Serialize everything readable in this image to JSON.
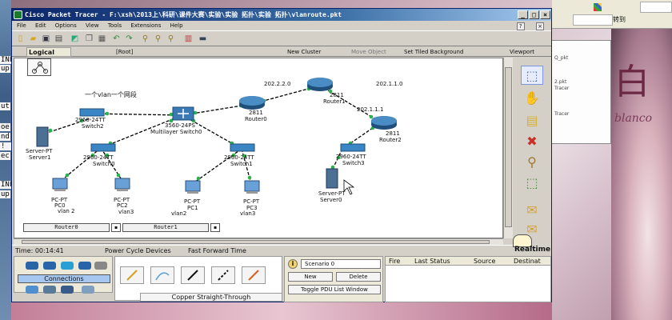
{
  "window": {
    "title": "Cisco Packet Tracer - F:\\xsh\\2013上\\科研\\课件大赛\\实验\\实验 拓扑\\实验 拓扑\\vlanroute.pkt",
    "menu": [
      "File",
      "Edit",
      "Options",
      "View",
      "Tools",
      "Extensions",
      "Help"
    ]
  },
  "workspace": {
    "logical_label": "Logical",
    "root_label": "[Root]",
    "new_cluster": "New Cluster",
    "move_object": "Move Object",
    "set_tiled_bg": "Set Tiled Background",
    "viewport": "Viewport"
  },
  "topology": {
    "annotation": "一个vlan一个网段",
    "network_labels": [
      "202.2.2.0",
      "202.1.1.0",
      "202.1.1.1"
    ],
    "devices": [
      {
        "type": "2811",
        "name": "Router1"
      },
      {
        "type": "2811",
        "name": "Router0"
      },
      {
        "type": "2811",
        "name": "Router2"
      },
      {
        "type": "3560-24PS",
        "name": "Multilayer Switch0"
      },
      {
        "type": "2960-24TT",
        "name": "Switch2"
      },
      {
        "type": "2960-24TT",
        "name": "Switch0"
      },
      {
        "type": "2960-24TT",
        "name": "Switch1"
      },
      {
        "type": "2960-24TT",
        "name": "Switch3"
      },
      {
        "type": "Server-PT",
        "name": "Server1"
      },
      {
        "type": "Server-PT",
        "name": "Server0"
      },
      {
        "type": "PC-PT",
        "name": "PC0"
      },
      {
        "type": "PC-PT",
        "name": "PC2"
      },
      {
        "type": "PC-PT",
        "name": "PC1"
      },
      {
        "type": "PC-PT",
        "name": "PC3"
      }
    ],
    "vlan_labels": [
      "vlan 2",
      "vlan3",
      "vlan2",
      "vlan3"
    ],
    "bottom_labels": [
      "Router0",
      "Router1"
    ]
  },
  "status_bar": {
    "time": "Time: 00:14:41",
    "power_cycle": "Power Cycle Devices",
    "fast_forward": "Fast Forward Time",
    "mode": "Realtime"
  },
  "device_panel": {
    "category": "Connections",
    "selected_caption": "Copper Straight-Through"
  },
  "scenario": {
    "info": "i",
    "select_value": "Scenario 0",
    "new_label": "New",
    "delete_label": "Delete",
    "toggle_label": "Toggle PDU List Window"
  },
  "pdu_list": {
    "columns": [
      "Fire",
      "Last Status",
      "Source",
      "Destinat"
    ]
  },
  "background": {
    "left_text": [
      "INF",
      "up",
      "ut",
      "oe",
      "nd",
      "! !",
      "ec",
      "INF",
      "up"
    ],
    "right_window_lines": [
      "Q_pkt",
      "2.pkt",
      "Tracer",
      "Tracer"
    ],
    "goto_label": "转到",
    "photo_big_text": "白",
    "photo_brand": "blanco"
  }
}
